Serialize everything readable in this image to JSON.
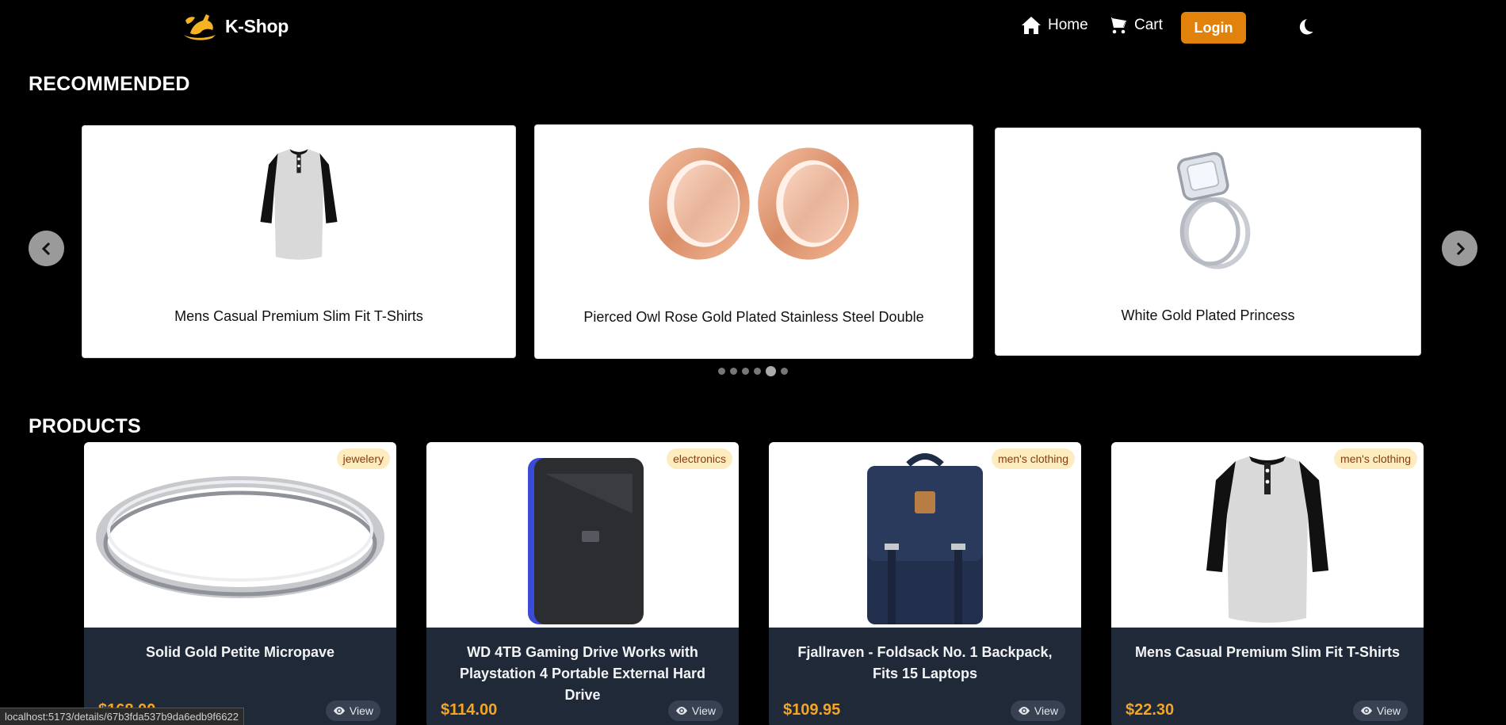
{
  "header": {
    "brand": "K-Shop",
    "nav": {
      "home": "Home",
      "cart": "Cart",
      "login": "Login"
    }
  },
  "recommended": {
    "title": "RECOMMENDED",
    "items": [
      {
        "name": "Mens Casual Premium Slim Fit T-Shirts"
      },
      {
        "name": "Pierced Owl Rose Gold Plated Stainless Steel Double"
      },
      {
        "name": "White Gold Plated Princess"
      }
    ],
    "dots_total": 6,
    "active_dot": 4
  },
  "products": {
    "title": "PRODUCTS",
    "items": [
      {
        "name": "Solid Gold Petite Micropave",
        "category": "jewelery",
        "price": "$168.00",
        "view": "View"
      },
      {
        "name": "WD 4TB Gaming Drive Works with Playstation 4 Portable External Hard Drive",
        "category": "electronics",
        "price": "$114.00",
        "view": "View"
      },
      {
        "name": "Fjallraven - Foldsack No. 1 Backpack, Fits 15 Laptops",
        "category": "men's clothing",
        "price": "$109.95",
        "view": "View"
      },
      {
        "name": "Mens Casual Premium Slim Fit T-Shirts",
        "category": "men's clothing",
        "price": "$22.30",
        "view": "View"
      }
    ]
  },
  "status_bar": {
    "url": "localhost:5173/details/67b3fda537b9da6edb9f6622"
  },
  "colors": {
    "accent": "#e0820c",
    "price": "#f5a524",
    "card_bg": "#1f2937",
    "badge_bg": "#fdecc0"
  }
}
